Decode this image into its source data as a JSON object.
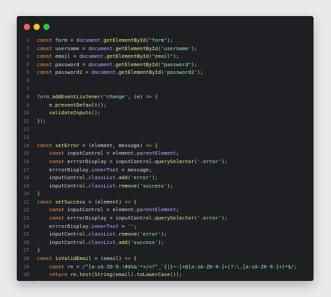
{
  "window": {
    "buttons": [
      {
        "name": "close",
        "color": "#ff5f56"
      },
      {
        "name": "minimize",
        "color": "#ffbd2e"
      },
      {
        "name": "maximize",
        "color": "#27c93f"
      }
    ]
  },
  "code": {
    "lines": [
      {
        "n": "1",
        "segs": [
          [
            "kw",
            "const "
          ],
          [
            "pl",
            "form = "
          ],
          [
            "var",
            "document"
          ],
          [
            "pl",
            "."
          ],
          [
            "fn",
            "getElementById"
          ],
          [
            "pl",
            "("
          ],
          [
            "str",
            "\"form\""
          ],
          [
            "pl",
            ");"
          ]
        ]
      },
      {
        "n": "2",
        "segs": [
          [
            "kw",
            "const "
          ],
          [
            "pl",
            "username = "
          ],
          [
            "var",
            "document"
          ],
          [
            "pl",
            "."
          ],
          [
            "fn",
            "getElementById"
          ],
          [
            "pl",
            "("
          ],
          [
            "str",
            "'username'"
          ],
          [
            "pl",
            ");"
          ]
        ]
      },
      {
        "n": "3",
        "segs": [
          [
            "kw",
            "const "
          ],
          [
            "pl",
            "email = "
          ],
          [
            "var",
            "document"
          ],
          [
            "pl",
            "."
          ],
          [
            "fn",
            "getElementById"
          ],
          [
            "pl",
            "("
          ],
          [
            "str",
            "\"email\""
          ],
          [
            "pl",
            ");"
          ]
        ]
      },
      {
        "n": "4",
        "segs": [
          [
            "kw",
            "const "
          ],
          [
            "pl",
            "password = "
          ],
          [
            "var",
            "document"
          ],
          [
            "pl",
            "."
          ],
          [
            "fn",
            "getElementById"
          ],
          [
            "pl",
            "("
          ],
          [
            "str",
            "\"password\""
          ],
          [
            "pl",
            ");"
          ]
        ]
      },
      {
        "n": "5",
        "segs": [
          [
            "kw",
            "const "
          ],
          [
            "pl",
            "password2 = "
          ],
          [
            "var",
            "document"
          ],
          [
            "pl",
            "."
          ],
          [
            "fn",
            "getElementById"
          ],
          [
            "pl",
            "("
          ],
          [
            "str",
            "'password2'"
          ],
          [
            "pl",
            ");"
          ]
        ]
      },
      {
        "n": "6",
        "segs": []
      },
      {
        "n": "7",
        "segs": []
      },
      {
        "n": "8",
        "segs": [
          [
            "var",
            "form"
          ],
          [
            "pl",
            "."
          ],
          [
            "fn",
            "addEventListener"
          ],
          [
            "pl",
            "("
          ],
          [
            "str",
            "'change'"
          ],
          [
            "pl",
            ", (e) "
          ],
          [
            "kw",
            "=>"
          ],
          [
            "pl",
            " {"
          ]
        ]
      },
      {
        "n": "9",
        "segs": [
          [
            "pl",
            "    e."
          ],
          [
            "fn",
            "preventDefault"
          ],
          [
            "pl",
            "();"
          ]
        ]
      },
      {
        "n": "10",
        "segs": [
          [
            "pl",
            "    "
          ],
          [
            "fn",
            "validateInputs"
          ],
          [
            "pl",
            "();"
          ]
        ]
      },
      {
        "n": "11",
        "segs": [
          [
            "pl",
            "});"
          ]
        ]
      },
      {
        "n": "12",
        "segs": []
      },
      {
        "n": "13",
        "segs": []
      },
      {
        "n": "14",
        "segs": [
          [
            "kw",
            "const "
          ],
          [
            "fn",
            "setError"
          ],
          [
            "pl",
            " = (element, message) "
          ],
          [
            "kw",
            "=>"
          ],
          [
            "pl",
            " {"
          ]
        ]
      },
      {
        "n": "15",
        "segs": [
          [
            "kw",
            "    const "
          ],
          [
            "pl",
            "inputControl = element."
          ],
          [
            "var",
            "parentElement"
          ],
          [
            "pl",
            ";"
          ]
        ]
      },
      {
        "n": "16",
        "segs": [
          [
            "kw",
            "    const "
          ],
          [
            "pl",
            "errrorDisplay = inputControl."
          ],
          [
            "fn",
            "querySelector"
          ],
          [
            "pl",
            "("
          ],
          [
            "str",
            "'.error'"
          ],
          [
            "pl",
            ");"
          ]
        ]
      },
      {
        "n": "17",
        "segs": [
          [
            "pl",
            "    errrorDisplay."
          ],
          [
            "var",
            "innerText"
          ],
          [
            "pl",
            " = message;"
          ]
        ]
      },
      {
        "n": "18",
        "segs": [
          [
            "pl",
            "    inputControl."
          ],
          [
            "var",
            "classList"
          ],
          [
            "pl",
            "."
          ],
          [
            "fn",
            "add"
          ],
          [
            "pl",
            "("
          ],
          [
            "str",
            "'error'"
          ],
          [
            "pl",
            ");"
          ]
        ]
      },
      {
        "n": "19",
        "segs": [
          [
            "pl",
            "    inputControl."
          ],
          [
            "var",
            "classList"
          ],
          [
            "pl",
            "."
          ],
          [
            "fn",
            "remove"
          ],
          [
            "pl",
            "("
          ],
          [
            "str",
            "'success'"
          ],
          [
            "pl",
            ");"
          ]
        ]
      },
      {
        "n": "20",
        "segs": [
          [
            "pl",
            "}"
          ]
        ]
      },
      {
        "n": "21",
        "segs": [
          [
            "kw",
            "const "
          ],
          [
            "fn",
            "setSuccess"
          ],
          [
            "pl",
            " = (element) "
          ],
          [
            "kw",
            "=>"
          ],
          [
            "pl",
            " {"
          ]
        ]
      },
      {
        "n": "22",
        "segs": [
          [
            "kw",
            "    const "
          ],
          [
            "pl",
            "inputControl = element."
          ],
          [
            "var",
            "parentElement"
          ],
          [
            "pl",
            ";"
          ]
        ]
      },
      {
        "n": "23",
        "segs": [
          [
            "kw",
            "    const "
          ],
          [
            "pl",
            "errrorDisplay = inputControl."
          ],
          [
            "fn",
            "querySelector"
          ],
          [
            "pl",
            "("
          ],
          [
            "str",
            "'.error'"
          ],
          [
            "pl",
            ");"
          ]
        ]
      },
      {
        "n": "24",
        "segs": [
          [
            "pl",
            "    errrorDisplay."
          ],
          [
            "var",
            "innerText"
          ],
          [
            "pl",
            " = "
          ],
          [
            "str",
            "''"
          ],
          [
            "pl",
            ";"
          ]
        ]
      },
      {
        "n": "25",
        "segs": [
          [
            "pl",
            "    inputControl."
          ],
          [
            "var",
            "classList"
          ],
          [
            "pl",
            "."
          ],
          [
            "fn",
            "remove"
          ],
          [
            "pl",
            "("
          ],
          [
            "str",
            "'error'"
          ],
          [
            "pl",
            ");"
          ]
        ]
      },
      {
        "n": "26",
        "segs": [
          [
            "pl",
            "    inputControl."
          ],
          [
            "var",
            "classList"
          ],
          [
            "pl",
            "."
          ],
          [
            "fn",
            "add"
          ],
          [
            "pl",
            "("
          ],
          [
            "str",
            "'success'"
          ],
          [
            "pl",
            ");"
          ]
        ]
      },
      {
        "n": "27",
        "segs": [
          [
            "pl",
            "}"
          ]
        ]
      },
      {
        "n": "28",
        "segs": [
          [
            "kw",
            "const "
          ],
          [
            "fn",
            "isValidEmail"
          ],
          [
            "pl",
            " = (email) "
          ],
          [
            "kw",
            "=>"
          ],
          [
            "pl",
            " {"
          ]
        ]
      },
      {
        "n": "29",
        "segs": [
          [
            "kw",
            "    const "
          ],
          [
            "pl",
            "re = "
          ],
          [
            "str",
            "/^[a-zA-Z0-9.!#$%&'*+/=?^_`{|}~-]+@[a-zA-Z0-9-]+(?:\\.[a-zA-Z0-9-]+)*$/"
          ],
          [
            "pl",
            ";"
          ]
        ]
      },
      {
        "n": "30",
        "segs": [
          [
            "kw",
            "    return "
          ],
          [
            "pl",
            "re."
          ],
          [
            "fn",
            "test"
          ],
          [
            "pl",
            "("
          ],
          [
            "fn",
            "String"
          ],
          [
            "pl",
            "(email)."
          ],
          [
            "fn",
            "toLowerCase"
          ],
          [
            "pl",
            "());"
          ]
        ]
      },
      {
        "n": "31",
        "segs": [
          [
            "pl",
            "}"
          ]
        ]
      }
    ]
  }
}
